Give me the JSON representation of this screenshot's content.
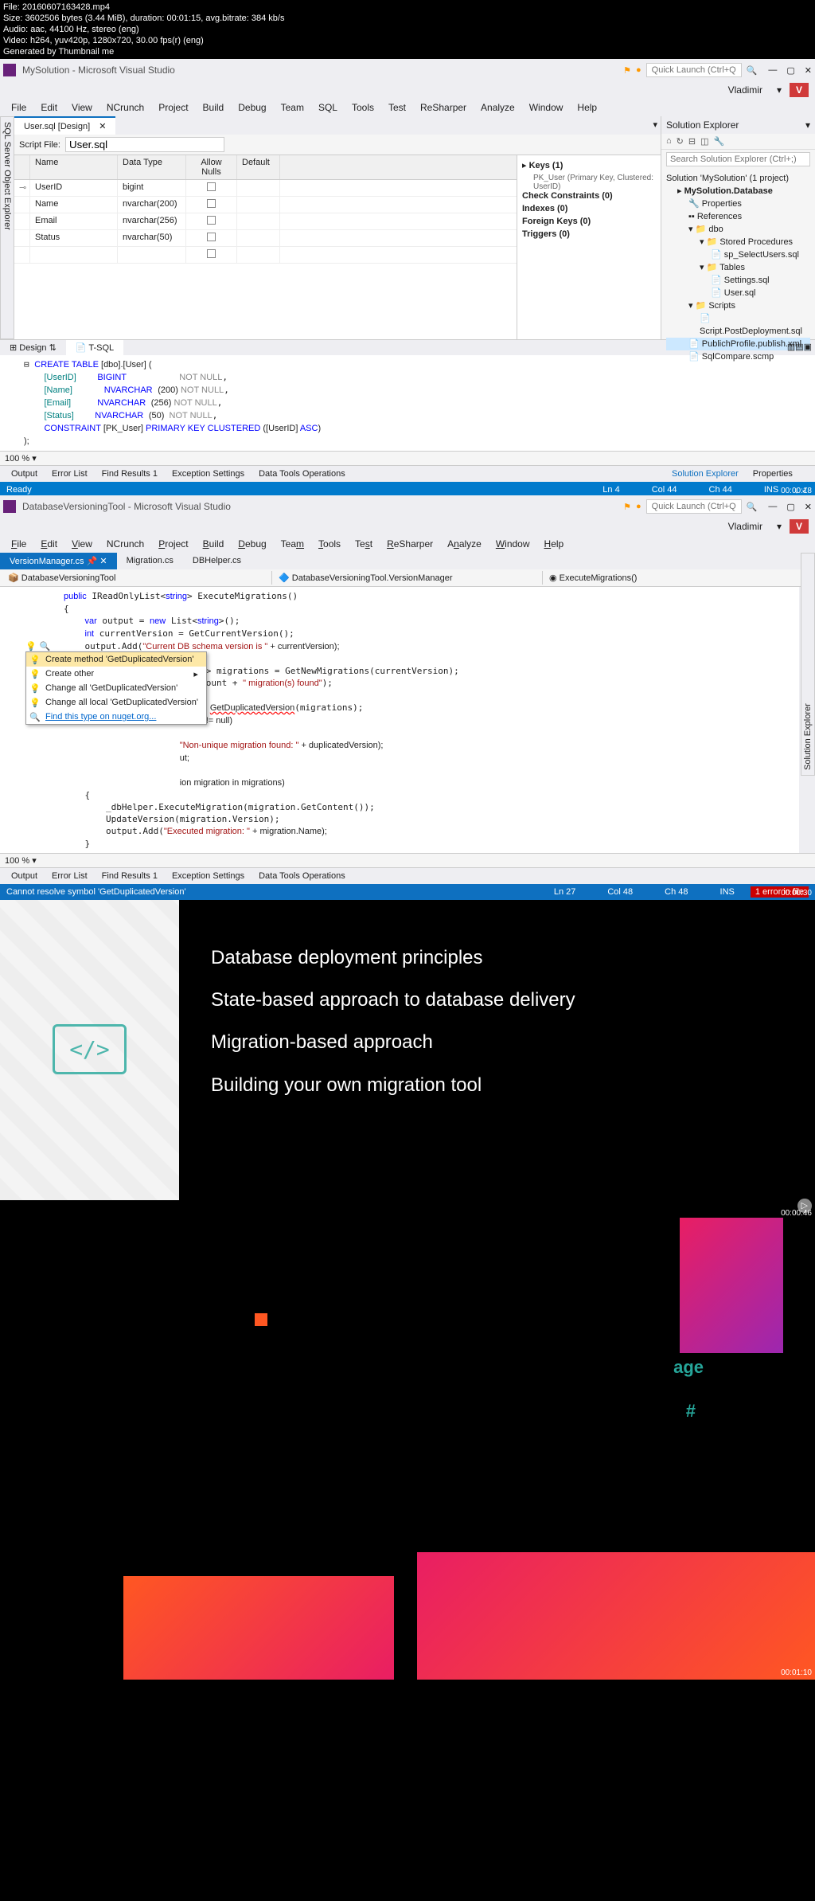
{
  "fileinfo": {
    "file": "File: 20160607163428.mp4",
    "size": "Size: 3602506 bytes (3.44 MiB), duration: 00:01:15, avg.bitrate: 384 kb/s",
    "audio": "Audio: aac, 44100 Hz, stereo (eng)",
    "video": "Video: h264, yuv420p, 1280x720, 30.00 fps(r) (eng)",
    "gen": "Generated by Thumbnail me"
  },
  "vs1": {
    "title": "MySolution - Microsoft Visual Studio",
    "search_placeholder": "Quick Launch (Ctrl+Q)",
    "user": "Vladimir",
    "user_badge": "V",
    "menu": [
      "File",
      "Edit",
      "View",
      "NCrunch",
      "Project",
      "Build",
      "Debug",
      "Team",
      "SQL",
      "Tools",
      "Test",
      "ReSharper",
      "Analyze",
      "Window",
      "Help"
    ],
    "side_tab": "SQL Server Object Explorer",
    "file_tab": "User.sql [Design]",
    "script_label": "Script File:",
    "script_value": "User.sql",
    "cols": {
      "name": "Name",
      "type": "Data Type",
      "nulls": "Allow Nulls",
      "def": "Default"
    },
    "rows": [
      {
        "pk": "⊸",
        "name": "UserID",
        "type": "bigint"
      },
      {
        "pk": "",
        "name": "Name",
        "type": "nvarchar(200)"
      },
      {
        "pk": "",
        "name": "Email",
        "type": "nvarchar(256)"
      },
      {
        "pk": "",
        "name": "Status",
        "type": "nvarchar(50)"
      }
    ],
    "keys": {
      "keys_label": "Keys (1)",
      "pk": "PK_User (Primary Key, Clustered: UserID)",
      "check": "Check Constraints (0)",
      "indexes": "Indexes (0)",
      "fk": "Foreign Keys (0)",
      "triggers": "Triggers (0)"
    },
    "design_tab": "Design",
    "tsql_tab": "T-SQL",
    "sql": {
      "l1a": "CREATE TABLE",
      "l1b": " [dbo].[User] (",
      "l2a": "    [UserID]",
      "l2b": "BIGINT",
      "l2c": "NOT NULL",
      "l3a": "    [Name]",
      "l3b": "NVARCHAR",
      "l3c": "(200)",
      "l3d": " NOT NULL",
      "l4a": "    [Email]",
      "l4b": "NVARCHAR",
      "l4c": "(256)",
      "l4d": " NOT NULL",
      "l5a": "    [Status]",
      "l5b": "NVARCHAR",
      "l5c": "(50)",
      "l5d": "  NOT NULL",
      "l6a": "    CONSTRAINT",
      "l6b": " [PK_User] ",
      "l6c": "PRIMARY KEY CLUSTERED",
      "l6d": " ([UserID] ",
      "l6e": "ASC",
      "l6f": ")",
      "l7": ");"
    },
    "zoom": "100 %",
    "solution": {
      "title": "Solution Explorer",
      "search": "Search Solution Explorer (Ctrl+;)",
      "root": "Solution 'MySolution' (1 project)",
      "proj": "MySolution.Database",
      "props": "Properties",
      "refs": "References",
      "dbo": "dbo",
      "sp": "Stored Procedures",
      "sp1": "sp_SelectUsers.sql",
      "tables": "Tables",
      "t1": "Settings.sql",
      "t2": "User.sql",
      "scripts": "Scripts",
      "s1": "Script.PostDeployment.sql",
      "pub": "PublichProfile.publish.xml",
      "cmp": "SqlCompare.scmp",
      "tab1": "Solution Explorer",
      "tab2": "Properties"
    },
    "bottom": [
      "Output",
      "Error List",
      "Find Results 1",
      "Exception Settings",
      "Data Tools Operations"
    ],
    "status": {
      "ready": "Ready",
      "ln": "Ln 4",
      "col": "Col 44",
      "ch": "Ch 44",
      "ins": "INS"
    },
    "ts": "00:00:18"
  },
  "vs2": {
    "title": "DatabaseVersioningTool - Microsoft Visual Studio",
    "search_placeholder": "Quick Launch (Ctrl+Q)",
    "user": "Vladimir",
    "user_badge": "V",
    "menu": [
      "File",
      "Edit",
      "View",
      "NCrunch",
      "Project",
      "Build",
      "Debug",
      "Team",
      "Tools",
      "Test",
      "ReSharper",
      "Analyze",
      "Window",
      "Help"
    ],
    "tabs": [
      "VersionManager.cs",
      "Migration.cs",
      "DBHelper.cs"
    ],
    "crumbs": [
      "DatabaseVersioningTool",
      "DatabaseVersioningTool.VersionManager",
      "ExecuteMigrations()"
    ],
    "code": {
      "l1": "public IReadOnlyList<string> ExecuteMigrations()",
      "l2": "{",
      "l3": "    var output = new List<string>();",
      "l4": "    int currentVersion = GetCurrentVersion();",
      "l5a": "    output.Add(",
      "l5b": "\"Current DB schema version is \"",
      "l5c": " + currentVersion);",
      "l6": "",
      "l7": "    IReadOnlyList<Migration> migrations = GetNewMigrations(currentVersion);",
      "l8a": "    output.Add(migrations.Count + ",
      "l8b": "\" migration(s) found\"",
      "l8c": ");",
      "l9": "",
      "l10a": "    int? duplicatedVersion = ",
      "l10b": "GetDuplicatedVersion",
      "l10c": "(migrations);",
      "l11": "ersion != null)",
      "l12a": "\"Non-unique migration found: \"",
      "l12b": " + duplicatedVersion);",
      "l13": "ut;",
      "l14": "",
      "l15": "ion migration in migrations)",
      "l16": "{",
      "l17": "    _dbHelper.ExecuteMigration(migration.GetContent());",
      "l18": "    UpdateVersion(migration.Version);",
      "l19a": "    output.Add(",
      "l19b": "\"Executed migration: \"",
      "l19c": " + migration.Name);",
      "l20": "}"
    },
    "menu_items": [
      "Create method 'GetDuplicatedVersion'",
      "Create other",
      "Change all 'GetDuplicatedVersion'",
      "Change all local 'GetDuplicatedVersion'",
      "Find this type on nuget.org..."
    ],
    "zoom": "100 %",
    "bottom": [
      "Output",
      "Error List",
      "Find Results 1",
      "Exception Settings",
      "Data Tools Operations"
    ],
    "status": {
      "msg": "Cannot resolve symbol 'GetDuplicatedVersion'",
      "ln": "Ln 27",
      "col": "Col 48",
      "ch": "Ch 48",
      "ins": "INS",
      "err": "1 error in file"
    },
    "ts": "00:00:30",
    "side": "Solution Explorer"
  },
  "slide": {
    "p1": "Database deployment principles",
    "p2": "State-based approach to database delivery",
    "p3": "Migration-based approach",
    "p4": "Building your own migration tool",
    "ts": "00:00:46"
  },
  "geo": {
    "t1": "age",
    "t2": "#",
    "ts": "00:01:10"
  }
}
